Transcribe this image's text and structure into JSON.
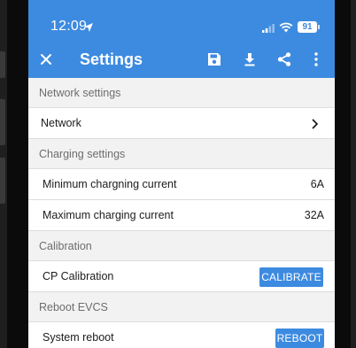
{
  "status_bar": {
    "time": "12:09",
    "battery": "91"
  },
  "app_bar": {
    "title": "Settings"
  },
  "sections": {
    "network": {
      "header": "Network settings",
      "rows": [
        {
          "label": "Network"
        }
      ]
    },
    "charging": {
      "header": "Charging settings",
      "rows": [
        {
          "label": "Minimum chargning current",
          "value": "6A"
        },
        {
          "label": "Maximum charging current",
          "value": "32A"
        }
      ]
    },
    "calibration": {
      "header": "Calibration",
      "rows": [
        {
          "label": "CP Calibration",
          "button": "CALIBRATE"
        }
      ]
    },
    "reboot": {
      "header": "Reboot EVCS",
      "rows": [
        {
          "label": "System reboot",
          "button": "REBOOT"
        }
      ]
    }
  },
  "colors": {
    "accent": "#3d8be0",
    "section_bg": "#f2f2f2",
    "text": "#1c1c1c"
  },
  "icons": [
    "location-arrow-icon",
    "signal-icon",
    "wifi-icon",
    "battery-icon",
    "close-icon",
    "save-icon",
    "download-icon",
    "share-icon",
    "more-vertical-icon",
    "chevron-right-icon"
  ]
}
